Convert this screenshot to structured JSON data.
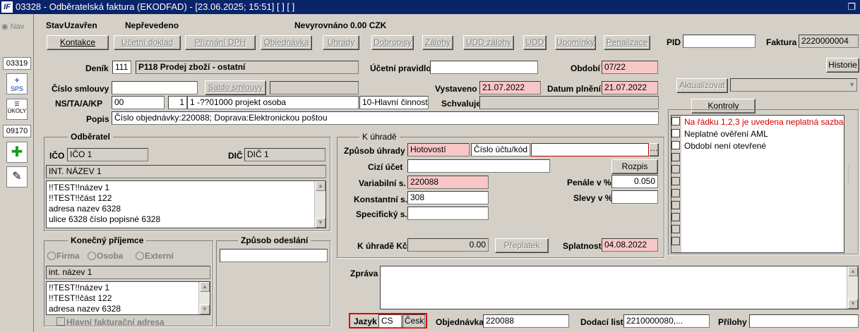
{
  "window": {
    "title": "03328 - Odběratelská faktura (EKODFAD) - [23.06.2025; 15:51]  [ ]  [ ]",
    "restore_icon": "restore-icon"
  },
  "sidebar": {
    "nav": "Nav",
    "code1": "03319",
    "sps": "SPS",
    "ukoly": "ÚKOLY",
    "code2": "09170"
  },
  "status": {
    "stav_label": "Stav",
    "stav_value": "Uzavřen",
    "neprevedeno": "Nepřevedeno",
    "nevyrovnano_label": "Nevyrovnáno",
    "nevyrovnano_value": "0.00 CZK"
  },
  "toolbar": {
    "kontakce": "Kontakce",
    "ucetni_doklad": "Účetní doklad",
    "priznani_dph": "Přiznání DPH",
    "objednavka": "Objednávka",
    "uhrady": "Úhrady",
    "dobropisy": "Dobropisy",
    "zalohy": "Zálohy",
    "udd_zalohy": "UDD zálohy",
    "udd": "UDD",
    "upominky": "Upomínky",
    "penalizace": "Penalizace"
  },
  "pid": {
    "label": "PID",
    "value": ""
  },
  "faktura": {
    "label": "Faktura",
    "value": "2220000004"
  },
  "denik": {
    "label": "Deník",
    "code": "111",
    "name": "P118 Prodej zboží - ostatní"
  },
  "ucetni_pravidlo": {
    "label": "Účetní pravidlo",
    "value": ""
  },
  "obdobi": {
    "label": "Období",
    "value": "07/22"
  },
  "historie": "Historie",
  "cislo_smlouvy": {
    "label": "Číslo smlouvy",
    "value": "",
    "saldo": "Saldo smlouvy",
    "extra": ""
  },
  "vystaveno": {
    "label": "Vystaveno",
    "value": "21.07.2022"
  },
  "datum_plneni": {
    "label": "Datum plnění",
    "value": "21.07.2022"
  },
  "aktualizovat": "Aktualizovat",
  "ns": {
    "label": "NS/TA/A/KP",
    "v1": "00",
    "v2": "",
    "v3": "1",
    "v4": "1 -??01000 projekt osoba",
    "v5": "10-Hlavní činnost"
  },
  "schvaluje": {
    "label": "Schvaluje",
    "value": ""
  },
  "popis": {
    "label": "Popis",
    "value": "Číslo objednávky:220088; Doprava:Elektronickou poštou"
  },
  "odberatel": {
    "title": "Odběratel",
    "ico_label": "IČO",
    "ico_value": "IČO 1",
    "dic_label": "DIČ",
    "dic_value": "DIČ 1",
    "name": "INT. NÁZEV 1",
    "address": [
      "!!TEST!!název 1",
      "!!TEST!!část 122",
      "adresa nazev 6328",
      "ulice 6328 číslo popisné 6328"
    ]
  },
  "uhrade": {
    "title": "K úhradě",
    "zpusob_label": "Způsob úhrady",
    "zpusob_value": "Hotovostí",
    "ucet_placeholder": "Číslo účtu/kód ba",
    "ucet_value": "",
    "cizi_label": "Cizí účet",
    "cizi_value": "",
    "rozpis": "Rozpis",
    "vs_label": "Variabilní s.",
    "vs_value": "220088",
    "penale_label": "Penále v %",
    "penale_value": "0.050",
    "ks_label": "Konstantní s.",
    "ks_value": "308",
    "slevy_label": "Slevy v %",
    "slevy_value": "",
    "ss_label": "Specifický s.",
    "ss_value": "",
    "kc_label": "K úhradě Kč",
    "kc_value": "0.00",
    "preplatek": "Přeplatek",
    "splatnost_label": "Splatnost",
    "splatnost_value": "04.08.2022"
  },
  "kontroly": {
    "button": "Kontroly",
    "items": [
      "Na řádku 1,2,3 je uvedena neplatná sazba DPH",
      "Neplatné ověření AML",
      "Období není otevřené"
    ]
  },
  "prijemce": {
    "title": "Konečný příjemce",
    "firma": "Firma",
    "osoba": "Osoba",
    "externi": "Externí",
    "name": "int. název 1",
    "address": [
      "!!TEST!!název 1",
      "!!TEST!!část 122",
      "adresa nazev 6328"
    ],
    "hlavni": "Hlavní fakturační adresa"
  },
  "odeslani": {
    "title": "Způsob odeslání",
    "value": ""
  },
  "zprava": {
    "label": "Zpráva",
    "value": ""
  },
  "jazyk": {
    "label": "Jazyk",
    "code": "CS",
    "name": "Česky"
  },
  "objednavka": {
    "label": "Objednávka",
    "value": "220088"
  },
  "dodaci": {
    "label": "Dodací list",
    "value": "2210000080,..."
  },
  "prilohy": {
    "label": "Přílohy",
    "value": ""
  }
}
